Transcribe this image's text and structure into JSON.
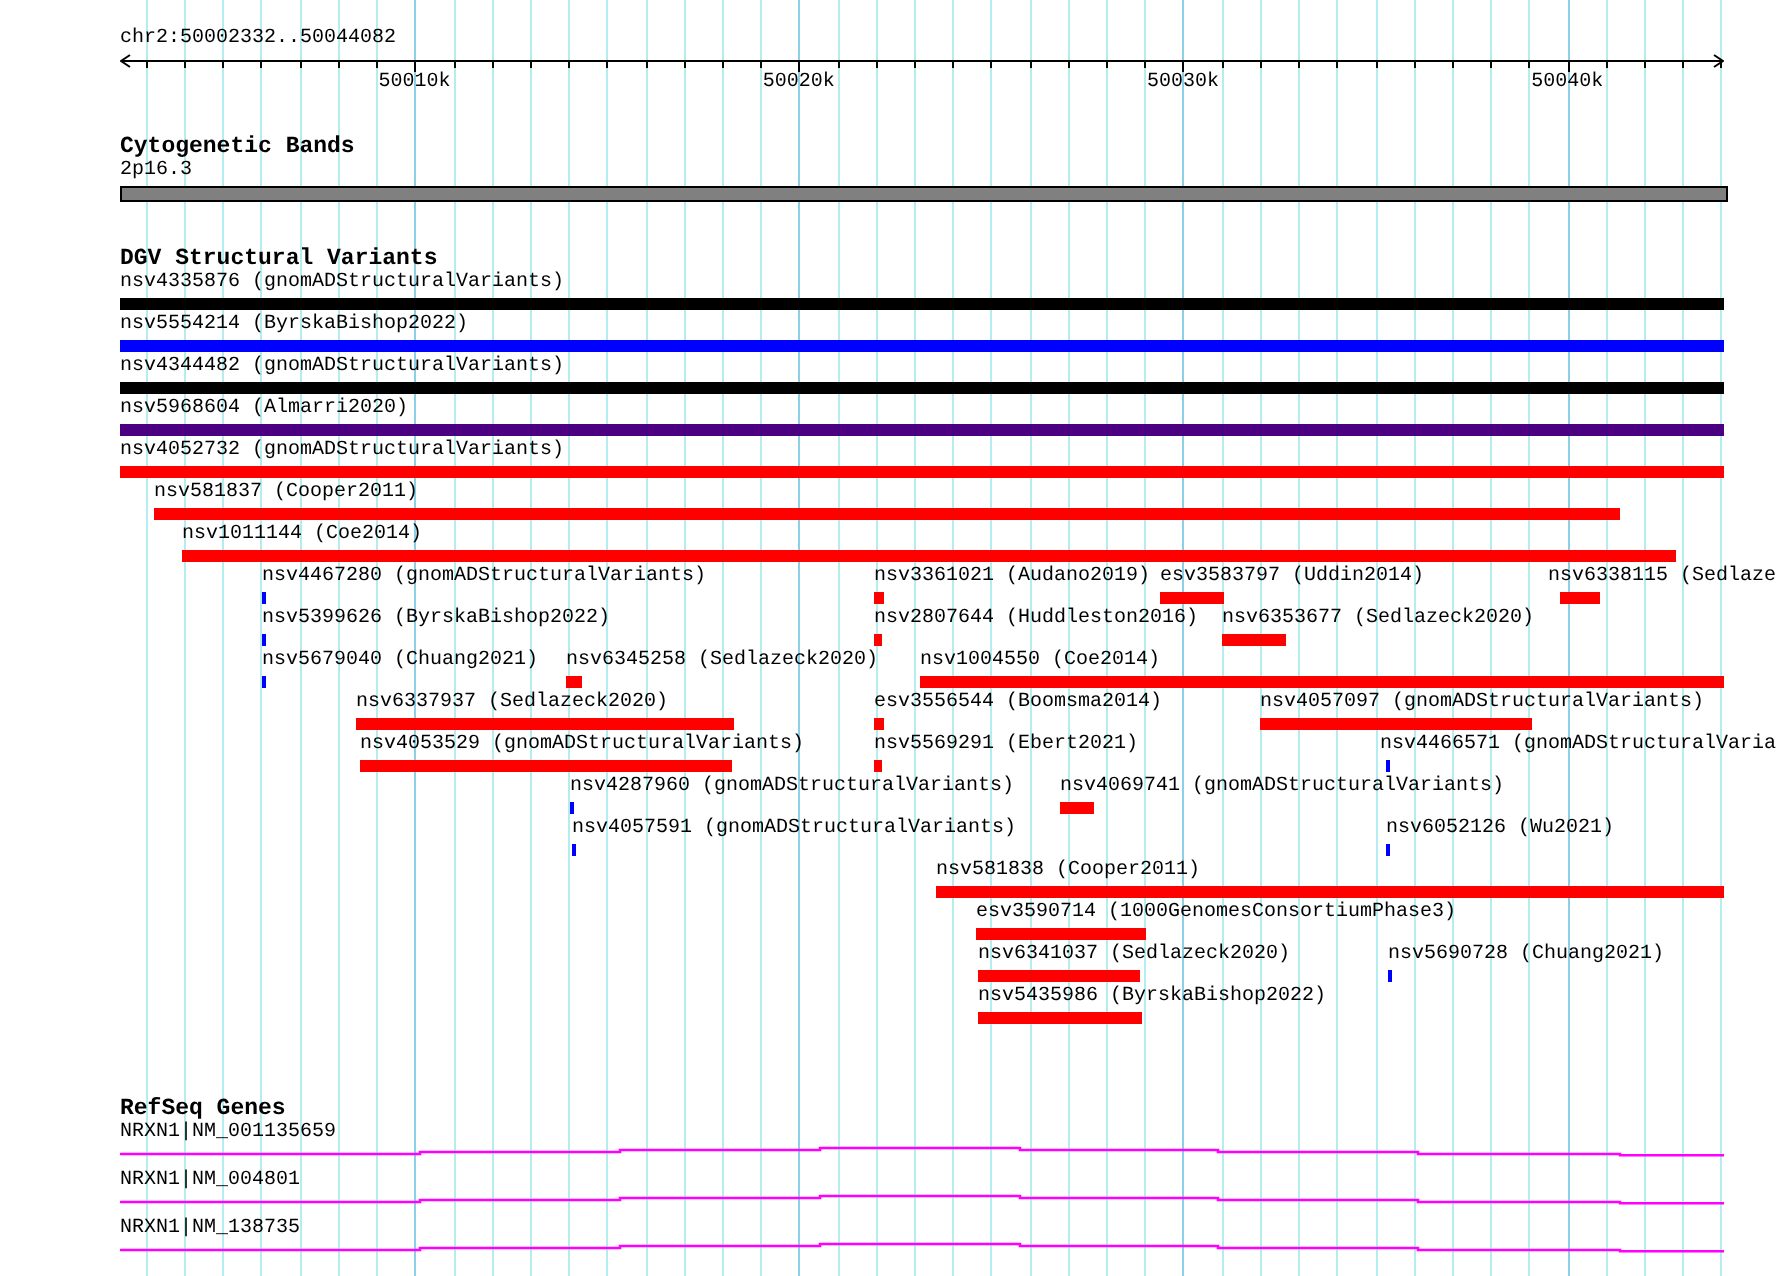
{
  "view": {
    "location": "chr2:50002332..50044082"
  },
  "ruler": {
    "ticks": [
      {
        "label": "50010k"
      },
      {
        "label": "50020k"
      },
      {
        "label": "50030k"
      },
      {
        "label": "50040k"
      }
    ]
  },
  "cytobands": {
    "title": "Cytogenetic Bands",
    "bands": [
      {
        "label": "2p16.3"
      }
    ]
  },
  "dgv": {
    "title": "DGV Structural Variants",
    "rows": [
      [
        {
          "label": "nsv4335876 (gnomADStructuralVariants)",
          "color": "#000000"
        }
      ],
      [
        {
          "label": "nsv5554214 (ByrskaBishop2022)",
          "color": "#0000ff"
        }
      ],
      [
        {
          "label": "nsv4344482 (gnomADStructuralVariants)",
          "color": "#000000"
        }
      ],
      [
        {
          "label": "nsv5968604 (Almarri2020)",
          "color": "#4b0082"
        }
      ],
      [
        {
          "label": "nsv4052732 (gnomADStructuralVariants)",
          "color": "#ff0000"
        }
      ],
      [
        {
          "label": "nsv581837 (Cooper2011)",
          "color": "#ff0000"
        }
      ],
      [
        {
          "label": "nsv1011144 (Coe2014)",
          "color": "#ff0000"
        }
      ],
      [
        {
          "label": "nsv4467280 (gnomADStructuralVariants)",
          "color": "#0000ff"
        },
        {
          "label": "nsv3361021 (Audano2019)",
          "color": "#ff0000"
        },
        {
          "label": "esv3583797 (Uddin2014)",
          "color": "#ff0000"
        },
        {
          "label": "nsv6338115 (Sedlaze",
          "color": "#ff0000"
        }
      ],
      [
        {
          "label": "nsv5399626 (ByrskaBishop2022)",
          "color": "#0000ff"
        },
        {
          "label": "nsv2807644 (Huddleston2016)",
          "color": "#ff0000"
        },
        {
          "label": "nsv6353677 (Sedlazeck2020)",
          "color": "#ff0000"
        }
      ],
      [
        {
          "label": "nsv5679040 (Chuang2021)",
          "color": "#0000ff"
        },
        {
          "label": "nsv6345258 (Sedlazeck2020)",
          "color": "#ff0000"
        },
        {
          "label": "nsv1004550 (Coe2014)",
          "color": "#ff0000"
        }
      ],
      [
        {
          "label": "nsv6337937 (Sedlazeck2020)",
          "color": "#ff0000"
        },
        {
          "label": "esv3556544 (Boomsma2014)",
          "color": "#ff0000"
        },
        {
          "label": "nsv4057097 (gnomADStructuralVariants)",
          "color": "#ff0000"
        }
      ],
      [
        {
          "label": "nsv4053529 (gnomADStructuralVariants)",
          "color": "#ff0000"
        },
        {
          "label": "nsv5569291 (Ebert2021)",
          "color": "#ff0000"
        },
        {
          "label": "nsv4466571 (gnomADStructuralVaria",
          "color": "#0000ff"
        }
      ],
      [
        {
          "label": "nsv4287960 (gnomADStructuralVariants)",
          "color": "#0000ff"
        },
        {
          "label": "nsv4069741 (gnomADStructuralVariants)",
          "color": "#ff0000"
        }
      ],
      [
        {
          "label": "nsv4057591 (gnomADStructuralVariants)",
          "color": "#0000ff"
        },
        {
          "label": "nsv6052126 (Wu2021)",
          "color": "#0000ff"
        }
      ],
      [
        {
          "label": "nsv581838 (Cooper2011)",
          "color": "#ff0000"
        }
      ],
      [
        {
          "label": "esv3590714 (1000GenomesConsortiumPhase3)",
          "color": "#ff0000"
        }
      ],
      [
        {
          "label": "nsv6341037 (Sedlazeck2020)",
          "color": "#ff0000"
        },
        {
          "label": "nsv5690728 (Chuang2021)",
          "color": "#0000ff"
        }
      ],
      [
        {
          "label": "nsv5435986 (ByrskaBishop2022)",
          "color": "#ff0000"
        }
      ]
    ]
  },
  "genes": {
    "title": "RefSeq Genes",
    "transcripts": [
      {
        "label": "NRXN1|NM_001135659"
      },
      {
        "label": "NRXN1|NM_004801"
      },
      {
        "label": "NRXN1|NM_138735"
      }
    ]
  }
}
